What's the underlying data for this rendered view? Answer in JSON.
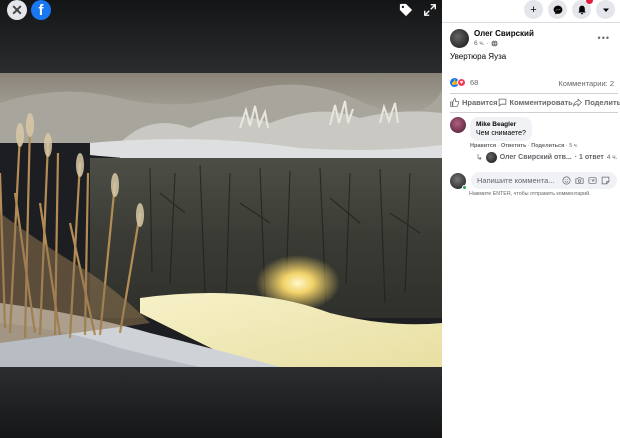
{
  "viewer": {
    "close_icon": "close-icon",
    "logo_letter": "f",
    "tag_icon": "tag-icon",
    "expand_icon": "expand-icon"
  },
  "topbar": {
    "icons": [
      "plus-icon",
      "messenger-icon",
      "bell-icon",
      "chevron-down-icon"
    ]
  },
  "post": {
    "author": "Олег Свирский",
    "time": "6 ч.",
    "privacy_icon": "globe-icon",
    "caption": "Увертюра Яуза",
    "reactions_count": "68",
    "comments_count": "Комментарии: 2",
    "actions": {
      "like": "Нравится",
      "comment": "Комментировать",
      "share": "Поделиться"
    }
  },
  "comments": [
    {
      "author": "Mike Beagler",
      "text": "Чем снимаете?",
      "like": "Нравится",
      "reply": "Ответить",
      "share": "Поделиться",
      "time": "5 ч.",
      "replies": {
        "author": "Олег Свирский отв...",
        "count_text": "· 1 ответ",
        "time": "4 ч."
      }
    }
  ],
  "composer": {
    "placeholder": "Напишите коммента...",
    "hint": "Нажмите ENTER, чтобы отправить комментарий."
  },
  "colors": {
    "brand": "#1877f2",
    "love": "#f33e58",
    "online": "#31a24c",
    "notification_badge": "#e41e3f"
  }
}
